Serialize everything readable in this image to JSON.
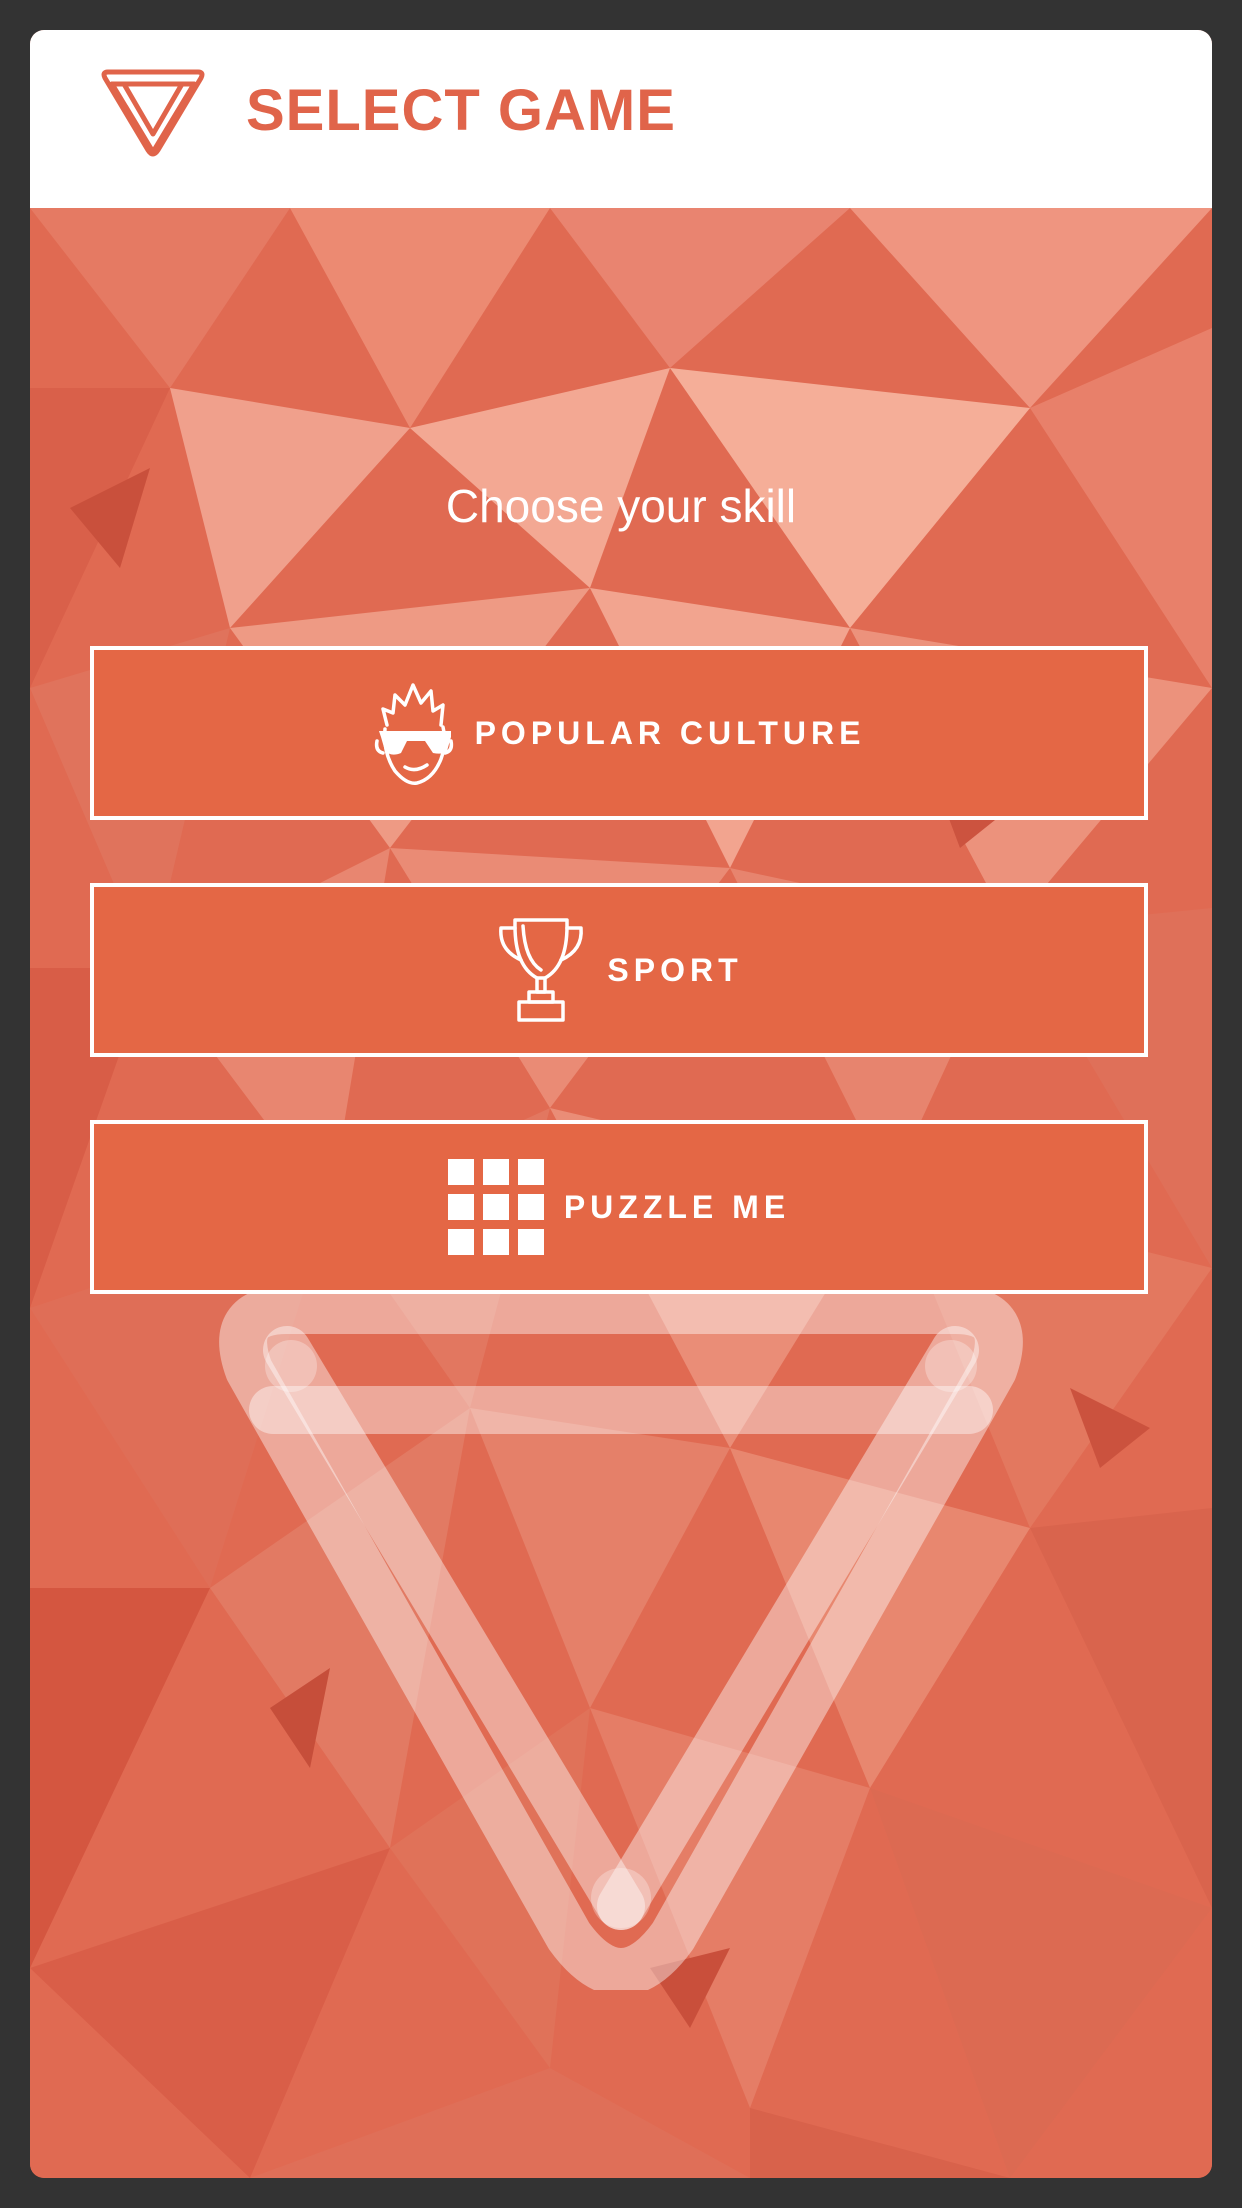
{
  "header": {
    "title": "SELECT GAME",
    "logo_icon": "inverted-triangle-logo-icon"
  },
  "main": {
    "subtitle": "Choose your skill",
    "skills": [
      {
        "label": "POPULAR CULTURE",
        "icon": "face-with-sunglasses-icon"
      },
      {
        "label": "SPORT",
        "icon": "trophy-icon"
      },
      {
        "label": "PUZZLE ME",
        "icon": "grid-icon"
      }
    ],
    "watermark_icon": "inverted-triangle-watermark-icon"
  },
  "colors": {
    "accent": "#e0644a",
    "button_fill": "#e46745",
    "background": "#e0664d",
    "frame": "#333333",
    "header_bg": "#ffffff"
  }
}
